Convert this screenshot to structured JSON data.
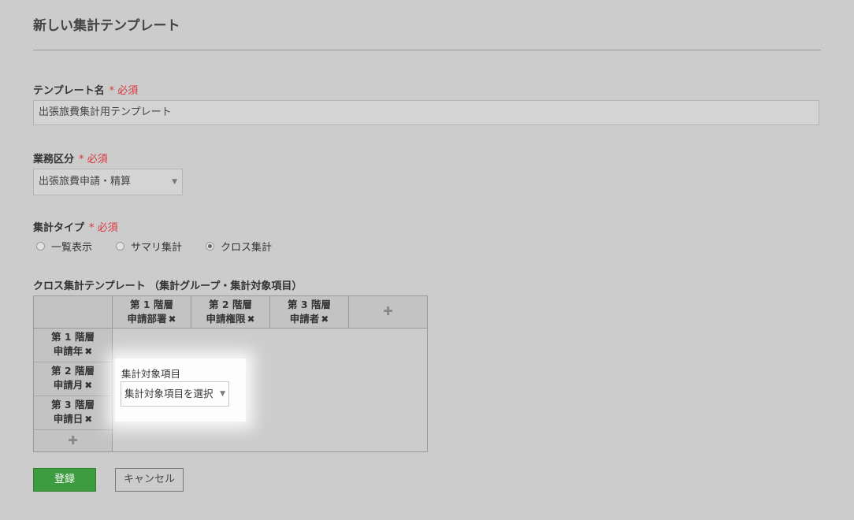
{
  "page": {
    "title": "新しい集計テンプレート"
  },
  "required_mark": "* 必須",
  "template_name": {
    "label": "テンプレート名",
    "value": "出張旅費集計用テンプレート"
  },
  "business_category": {
    "label": "業務区分",
    "selected": "出張旅費申請・精算"
  },
  "aggregation_type": {
    "label": "集計タイプ",
    "options": [
      {
        "label": "一覧表示",
        "checked": false
      },
      {
        "label": "サマリ集計",
        "checked": false
      },
      {
        "label": "クロス集計",
        "checked": true
      }
    ]
  },
  "cross_template": {
    "label": "クロス集計テンプレート （集計グループ・集計対象項目）",
    "columns": [
      {
        "level": "第 1 階層",
        "field": "申請部署"
      },
      {
        "level": "第 2 階層",
        "field": "申請権限"
      },
      {
        "level": "第 3 階層",
        "field": "申請者"
      }
    ],
    "rows": [
      {
        "level": "第 1 階層",
        "field": "申請年"
      },
      {
        "level": "第 2 階層",
        "field": "申請月"
      },
      {
        "level": "第 3 階層",
        "field": "申請日"
      }
    ],
    "remove_glyph": "✖",
    "add_glyph": "✚"
  },
  "target_popup": {
    "label": "集計対象項目",
    "placeholder": "集計対象項目を選択"
  },
  "buttons": {
    "submit": "登録",
    "cancel": "キャンセル"
  },
  "colors": {
    "primary": "#3d9b40",
    "required": "#d9363e",
    "background": "#cccccc"
  }
}
